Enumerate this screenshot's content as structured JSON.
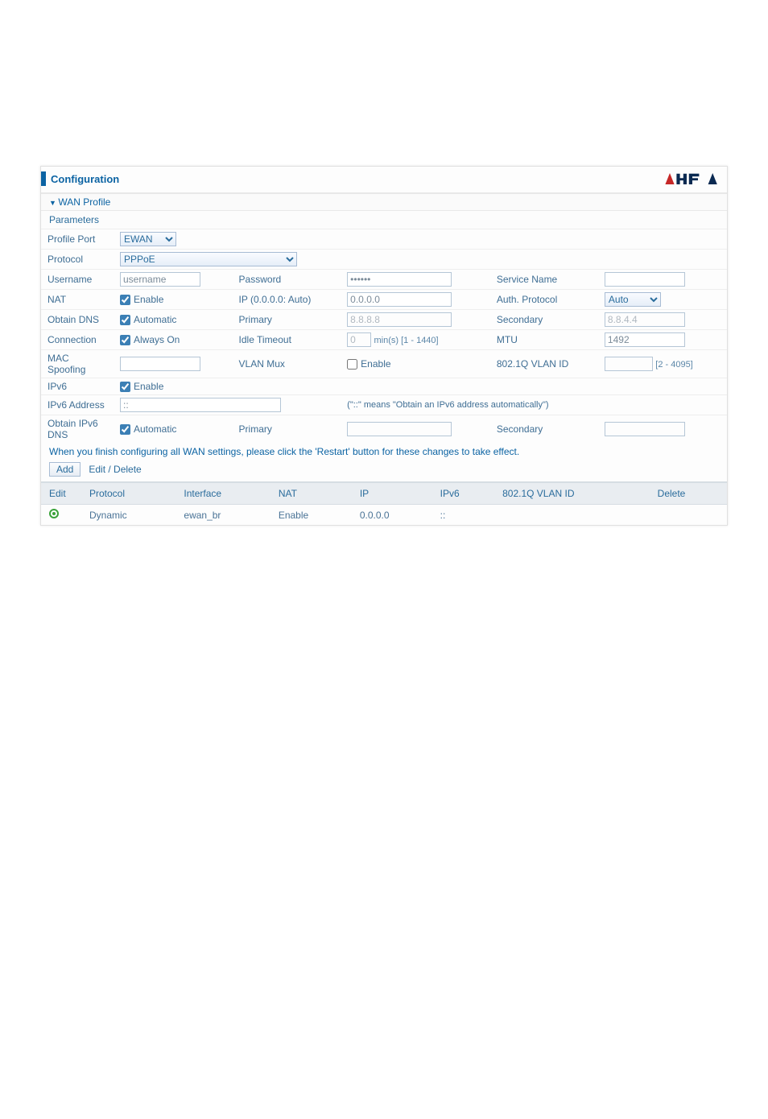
{
  "header": {
    "title": "Configuration"
  },
  "section": {
    "title": "WAN Profile",
    "params_label": "Parameters"
  },
  "rows": {
    "profile_port": {
      "label": "Profile Port",
      "value": "EWAN"
    },
    "protocol": {
      "label": "Protocol",
      "value": "PPPoE"
    },
    "username": {
      "label": "Username",
      "value": "username",
      "password_label": "Password",
      "password_value": "••••••",
      "service_label": "Service Name",
      "service_value": ""
    },
    "nat": {
      "label": "NAT",
      "enable_label": "Enable",
      "ip_label": "IP (0.0.0.0: Auto)",
      "ip_value": "0.0.0.0",
      "auth_label": "Auth. Protocol",
      "auth_value": "Auto"
    },
    "dns": {
      "label": "Obtain DNS",
      "automatic_label": "Automatic",
      "primary_label": "Primary",
      "primary_value": "8.8.8.8",
      "secondary_label": "Secondary",
      "secondary_value": "8.8.4.4"
    },
    "connection": {
      "label": "Connection",
      "always_label": "Always On",
      "idle_label": "Idle Timeout",
      "idle_value": "0",
      "idle_unit": "min(s) [1 - 1440]",
      "mtu_label": "MTU",
      "mtu_value": "1492"
    },
    "mac": {
      "label": "MAC Spoofing",
      "value": "",
      "vlan_label": "VLAN Mux",
      "vlan_enable_label": "Enable",
      "vlanid_label": "802.1Q VLAN ID",
      "vlanid_value": "",
      "vlanid_range": "[2 - 4095]"
    },
    "ipv6": {
      "label": "IPv6",
      "enable_label": "Enable"
    },
    "ipv6addr": {
      "label": "IPv6 Address",
      "value": "::",
      "hint": "(\"::\" means \"Obtain an IPv6 address automatically\")"
    },
    "ipv6dns": {
      "label": "Obtain IPv6 DNS",
      "automatic_label": "Automatic",
      "primary_label": "Primary",
      "primary_value": "",
      "secondary_label": "Secondary",
      "secondary_value": ""
    }
  },
  "notes": {
    "restart": "When you finish configuring all WAN settings, please click the 'Restart' button for these changes to take effect.",
    "add_btn": "Add",
    "editdel_label": "Edit / Delete"
  },
  "list": {
    "headers": {
      "edit": "Edit",
      "protocol": "Protocol",
      "interface": "Interface",
      "nat": "NAT",
      "ip": "IP",
      "ipv6": "IPv6",
      "vlan": "802.1Q VLAN ID",
      "delete": "Delete"
    },
    "row": {
      "protocol": "Dynamic",
      "interface": "ewan_br",
      "nat": "Enable",
      "ip": "0.0.0.0",
      "ipv6": "::",
      "vlan": "",
      "delete": ""
    }
  }
}
